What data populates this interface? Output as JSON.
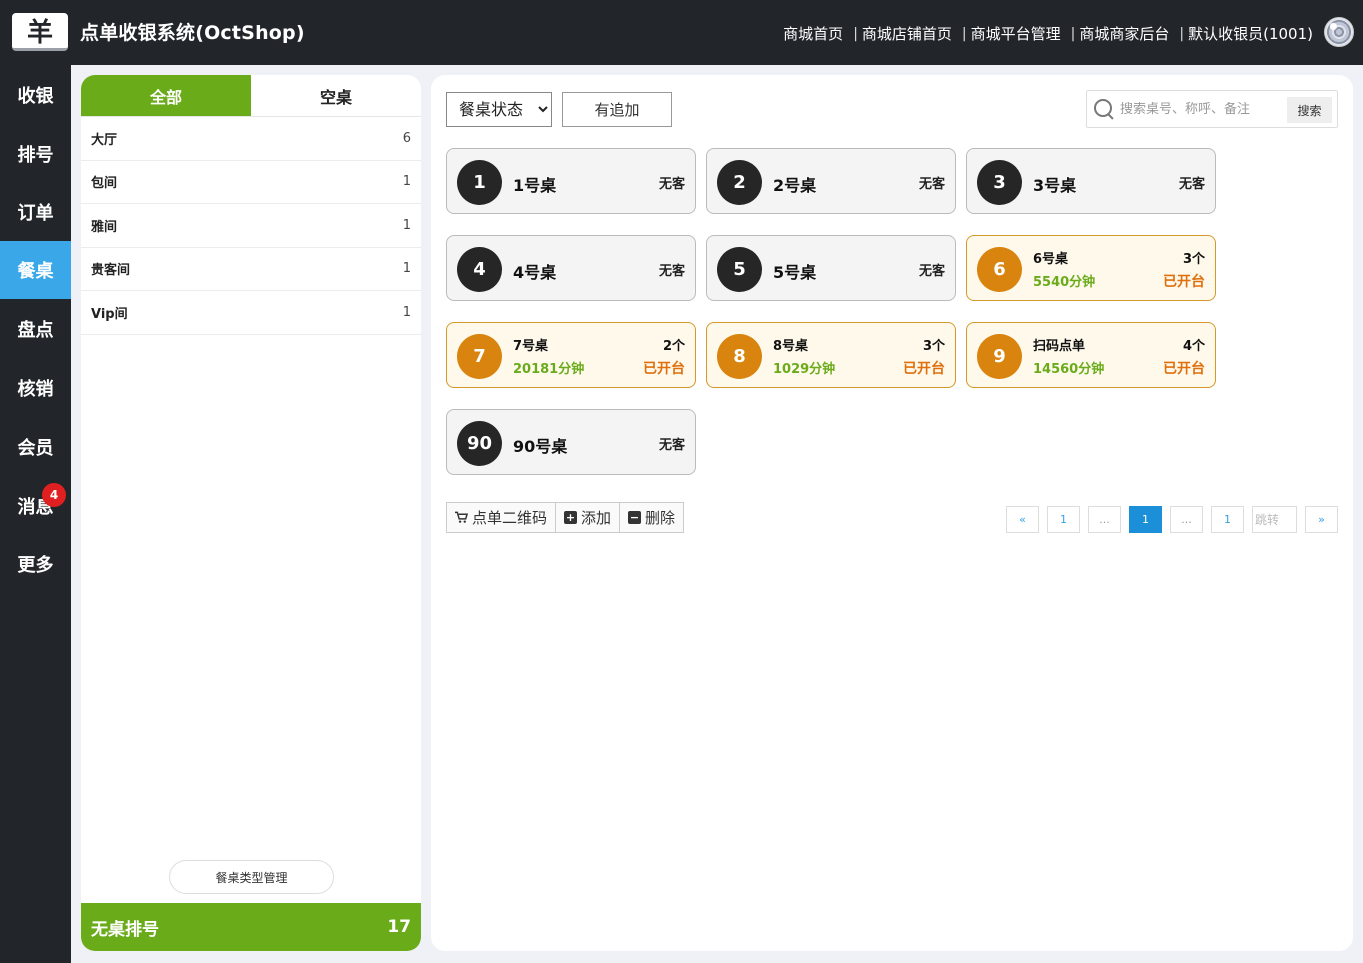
{
  "header": {
    "logo_glyph": "羊",
    "title": "点单收银系统(OctShop)",
    "links": [
      "商城首页",
      "商城店铺首页",
      "商城平台管理",
      "商城商家后台",
      "默认收银员(1001)"
    ],
    "separator": "|"
  },
  "sidebar": {
    "items": [
      {
        "label": "收银"
      },
      {
        "label": "排号"
      },
      {
        "label": "订单"
      },
      {
        "label": "餐桌"
      },
      {
        "label": "盘点"
      },
      {
        "label": "核销"
      },
      {
        "label": "会员"
      },
      {
        "label": "消息"
      },
      {
        "label": "更多"
      }
    ],
    "active_index": 3,
    "message_badge": "4"
  },
  "left_panel": {
    "tabs": [
      {
        "label": "全部"
      },
      {
        "label": "空桌"
      }
    ],
    "categories": [
      {
        "name": "大厅",
        "count": "6"
      },
      {
        "name": "包间",
        "count": "1"
      },
      {
        "name": "雅间",
        "count": "1"
      },
      {
        "name": "贵客间",
        "count": "1"
      },
      {
        "name": "Vip间",
        "count": "1"
      }
    ],
    "manage_label": "餐桌类型管理",
    "queue_label": "无桌排号",
    "queue_count": "17"
  },
  "toolbar": {
    "status_select": "餐桌状态",
    "append_label": "有追加",
    "search_placeholder": "搜索桌号、称呼、备注",
    "search_button": "搜索"
  },
  "tables": [
    {
      "num": "1",
      "name": "1号桌",
      "status": "无客"
    },
    {
      "num": "2",
      "name": "2号桌",
      "status": "无客"
    },
    {
      "num": "3",
      "name": "3号桌",
      "status": "无客"
    },
    {
      "num": "4",
      "name": "4号桌",
      "status": "无客"
    },
    {
      "num": "5",
      "name": "5号桌",
      "status": "无客"
    },
    {
      "num": "6",
      "name": "6号桌",
      "guests": "3个",
      "duration": "5540分钟",
      "status": "已开台"
    },
    {
      "num": "7",
      "name": "7号桌",
      "guests": "2个",
      "duration": "20181分钟",
      "status": "已开台"
    },
    {
      "num": "8",
      "name": "8号桌",
      "guests": "3个",
      "duration": "1029分钟",
      "status": "已开台"
    },
    {
      "num": "9",
      "name": "扫码点单",
      "guests": "4个",
      "duration": "14560分钟",
      "status": "已开台"
    },
    {
      "num": "90",
      "name": "90号桌",
      "status": "无客"
    }
  ],
  "actions": {
    "qrcode": "点单二维码",
    "add": "添加",
    "delete": "删除"
  },
  "pagination": {
    "prev": "«",
    "first": "1",
    "dots1": "...",
    "current": "1",
    "dots2": "...",
    "last": "1",
    "jump_placeholder": "跳转",
    "next": "»"
  },
  "colors": {
    "header_bg": "#22262b",
    "accent_green": "#6aab1a",
    "active_blue": "#3aa8e8",
    "open_orange": "#d9840e",
    "badge_red": "#e02020"
  }
}
